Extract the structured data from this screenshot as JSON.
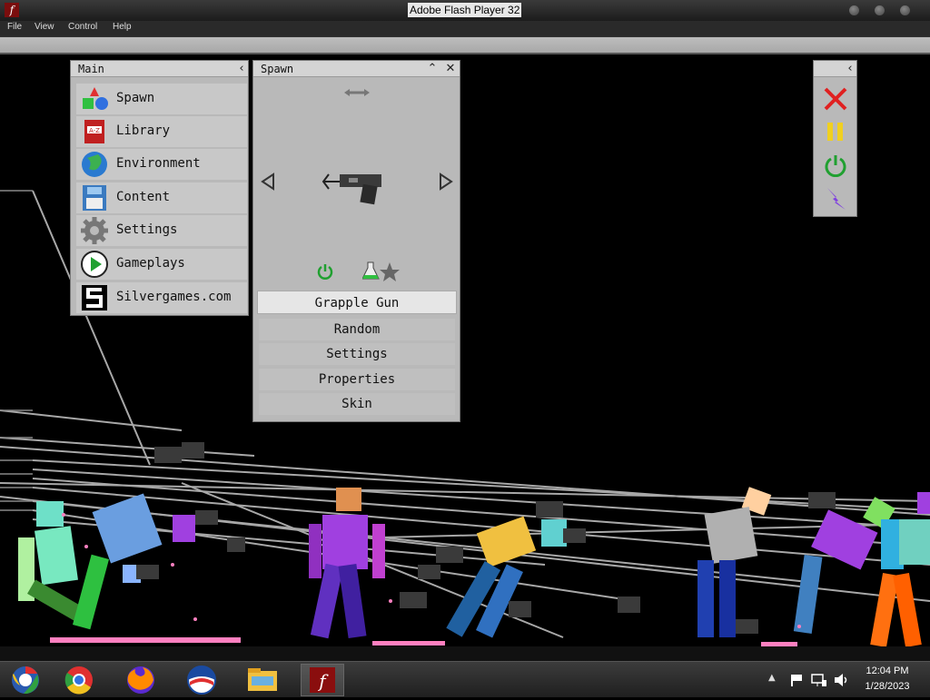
{
  "window": {
    "title": "Adobe Flash Player 32",
    "menu": [
      "File",
      "View",
      "Control",
      "Help"
    ]
  },
  "main_panel": {
    "title": "Main",
    "items": [
      {
        "label": "Spawn",
        "icon": "shapes-icon"
      },
      {
        "label": "Library",
        "icon": "book-icon"
      },
      {
        "label": "Environment",
        "icon": "globe-icon"
      },
      {
        "label": "Content",
        "icon": "floppy-disk-icon"
      },
      {
        "label": "Settings",
        "icon": "gear-icon"
      },
      {
        "label": "Gameplays",
        "icon": "play-icon"
      },
      {
        "label": "Silvergames.com",
        "icon": "silvergames-logo-icon"
      }
    ]
  },
  "spawn_panel": {
    "title": "Spawn",
    "selected_item": "Grapple Gun",
    "options": [
      "Random",
      "Settings",
      "Properties",
      "Skin"
    ]
  },
  "control_panel": {
    "buttons": [
      "close-red-x-icon",
      "pause-icon",
      "power-icon",
      "lightning-icon"
    ]
  },
  "taskbar": {
    "apps": [
      "chrome-alt-icon",
      "chrome-icon",
      "firefox-icon",
      "obama-logo-icon",
      "file-explorer-icon",
      "flash-player-icon"
    ],
    "time": "12:04 PM",
    "date": "1/28/2023"
  },
  "colors": {
    "panel_bg": "#b9b9b9",
    "stage_bg": "#000000"
  }
}
